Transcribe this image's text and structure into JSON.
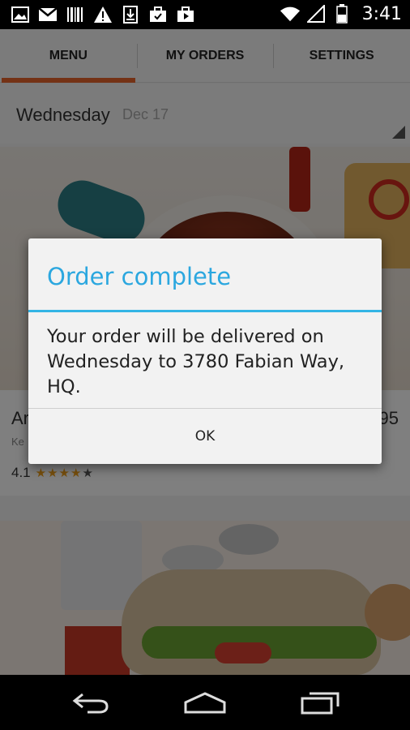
{
  "status_bar": {
    "time": "3:41",
    "left_icons": [
      "picture-icon",
      "gmail-icon",
      "barcode-icon",
      "warning-icon",
      "download-icon",
      "briefcase-icon",
      "briefcase-play-icon"
    ],
    "right_icons": [
      "wifi-icon",
      "signal-icon",
      "battery-icon"
    ]
  },
  "tabs": [
    {
      "label": "MENU",
      "active": true
    },
    {
      "label": "MY ORDERS",
      "active": false
    },
    {
      "label": "SETTINGS",
      "active": false
    }
  ],
  "day_selector": {
    "day": "Wednesday",
    "date": "Dec 17"
  },
  "menu_items": [
    {
      "title_visible": "Ar",
      "price_visible": "95",
      "subtitle_visible": "Ke",
      "rating": "4.1",
      "stars": 4
    }
  ],
  "dialog": {
    "title": "Order complete",
    "message": "Your order will be delivered on Wednesday to 3780 Fabian Way, HQ.",
    "ok_label": "OK"
  },
  "colors": {
    "accent_tab": "#e8652a",
    "dialog_title": "#2ba7df",
    "dialog_rule": "#33b5e5",
    "star": "#f0a01b"
  },
  "nav_bar": [
    "back-icon",
    "home-icon",
    "recent-apps-icon"
  ]
}
